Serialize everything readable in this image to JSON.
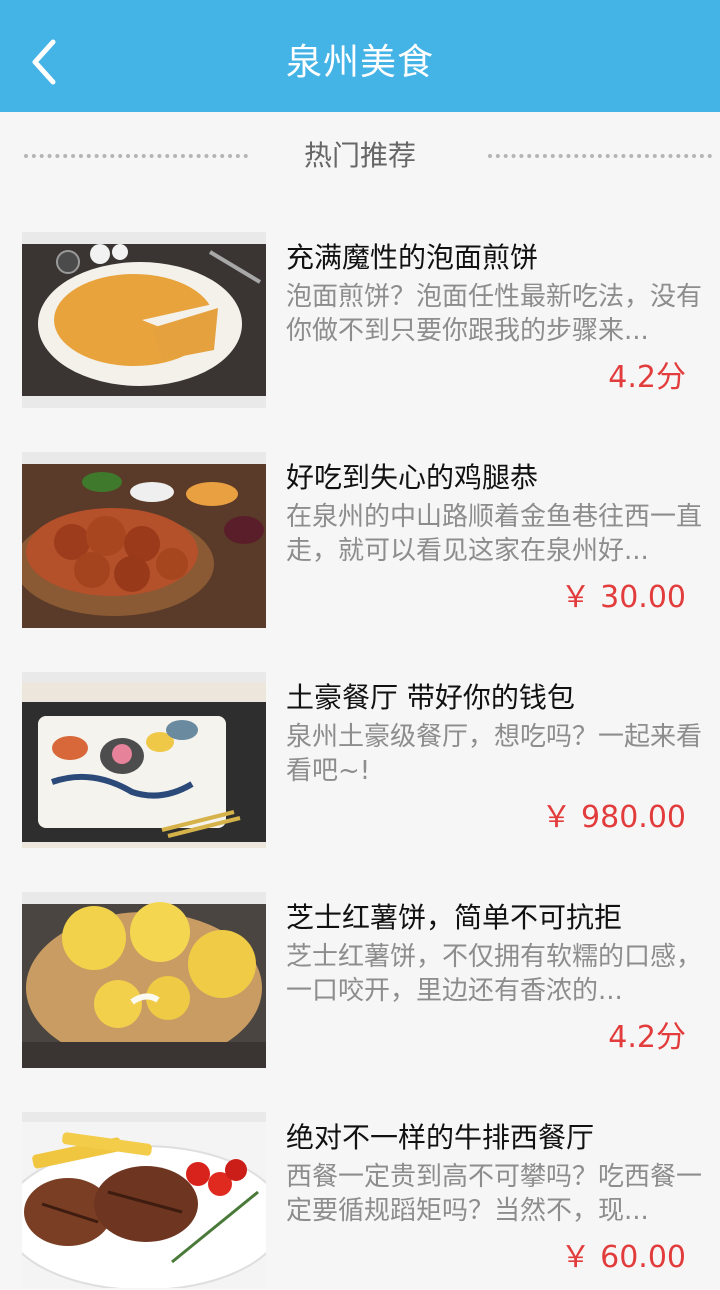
{
  "app": {
    "title": "泉州美食"
  },
  "section": {
    "title": "热门推荐"
  },
  "colors": {
    "header_bg": "#44b3e6",
    "price": "#e23c3c",
    "title_text": "#111111",
    "desc_text": "#8d8d8d"
  },
  "items": [
    {
      "title": "充满魔性的泡面煎饼",
      "desc": "泡面煎饼？泡面任性最新吃法，没有你做不到只要你跟我的步骤来...",
      "price": "4.2分"
    },
    {
      "title": "好吃到失心的鸡腿恭",
      "desc": "在泉州的中山路顺着金鱼巷往西一直走，就可以看见这家在泉州好...",
      "price": "￥ 30.00"
    },
    {
      "title": "土豪餐厅 带好你的钱包",
      "desc": "泉州土豪级餐厅，想吃吗？一起来看看吧~!",
      "price": "￥ 980.00"
    },
    {
      "title": "芝士红薯饼，简单不可抗拒",
      "desc": "芝士红薯饼，不仅拥有软糯的口感，一口咬开，里边还有香浓的...",
      "price": "4.2分"
    },
    {
      "title": "绝对不一样的牛排西餐厅",
      "desc": "西餐一定贵到高不可攀吗？吃西餐一定要循规蹈矩吗？当然不，现...",
      "price": "￥ 60.00"
    }
  ]
}
